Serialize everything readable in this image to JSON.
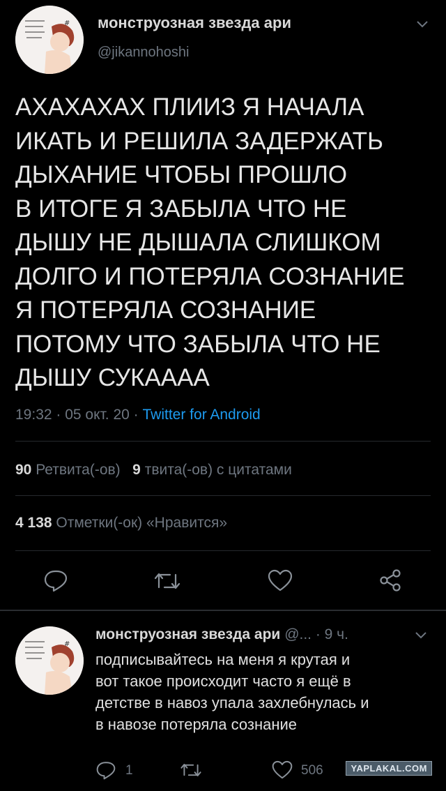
{
  "tweet": {
    "display_name": "монструозная звезда ари",
    "handle": "@jikannohoshi",
    "text_lines": [
      "АХАХАХАХ ПЛИИЗ Я НАЧАЛА",
      "ИКАТЬ И РЕШИЛА ЗАДЕРЖАТЬ",
      "ДЫХАНИЕ ЧТОБЫ ПРОШЛО",
      "В ИТОГЕ Я ЗАБЫЛА ЧТО НЕ",
      "ДЫШУ НЕ ДЫШАЛА СЛИШКОМ",
      "ДОЛГО И ПОТЕРЯЛА СОЗНАНИЕ",
      "Я ПОТЕРЯЛА СОЗНАНИЕ",
      "ПОТОМУ ЧТО ЗАБЫЛА ЧТО НЕ",
      "ДЫШУ СУКАААА"
    ],
    "meta_time": "19:32 · 05 окт. 20 · ",
    "meta_source": "Twitter for Android",
    "retweets_count": "90",
    "retweets_label": "Ретвита(-ов)",
    "quotes_count": "9",
    "quotes_label": "твита(-ов) с цитатами",
    "likes_count": "4 138",
    "likes_label": "Отметки(-ок) «Нравится»"
  },
  "reply": {
    "display_name": "монструозная звезда ари",
    "handle_time": "@... · 9 ч.",
    "text_lines": [
      "подписывайтесь на меня я крутая и",
      "вот такое происходит часто я ещё в",
      "детстве в навоз упала захлебнулась и",
      "в навозе потеряла сознание"
    ],
    "reply_count": "1",
    "like_count": "506"
  },
  "watermark": "YAPLAKAL.COM",
  "icons": [
    "chevron-down-icon",
    "reply-icon",
    "retweet-icon",
    "like-icon",
    "share-icon"
  ],
  "colors": {
    "background": "#000000",
    "text": "#d9d9d9",
    "muted": "#6e7680",
    "link": "#1d9bf0"
  }
}
